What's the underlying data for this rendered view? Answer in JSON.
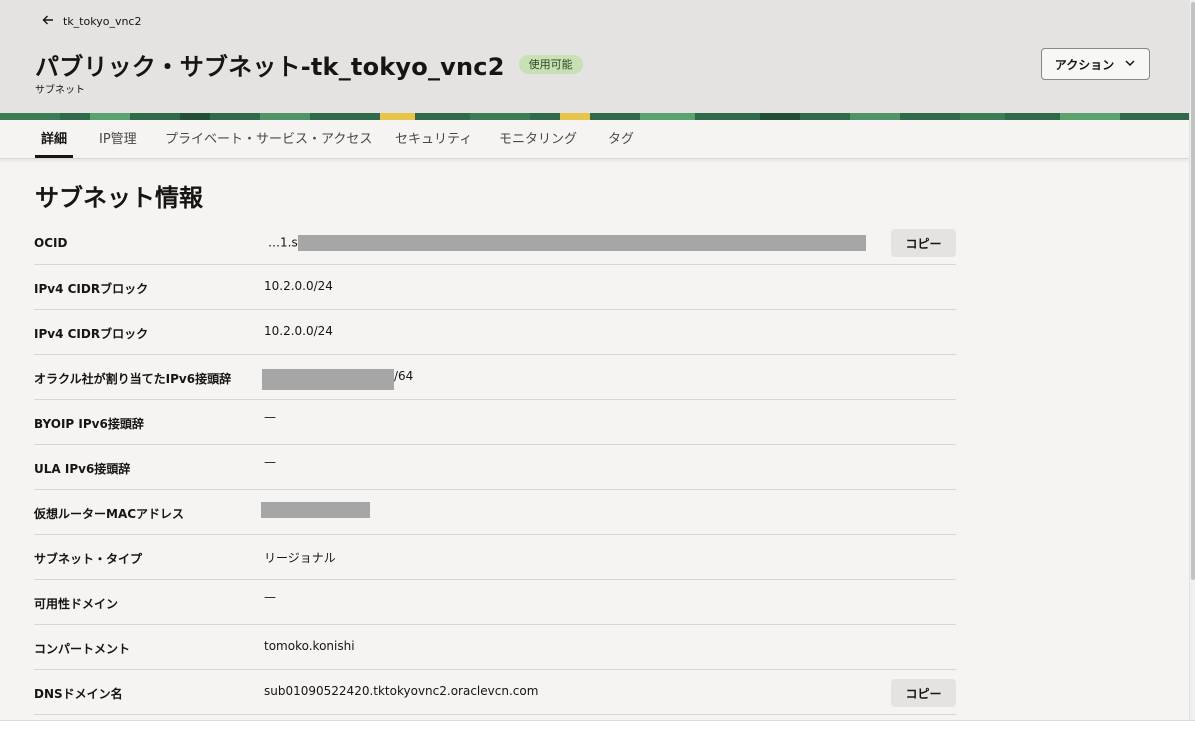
{
  "breadcrumb": {
    "label": "tk_tokyo_vnc2",
    "icon": "arrow-left-icon"
  },
  "header": {
    "title": "パブリック・サブネット-tk_tokyo_vnc2",
    "status_badge": "使用可能",
    "subtitle": "サブネット",
    "action_label": "アクション",
    "colors": {
      "badge_bg": "#c8e0b6",
      "banner_green": "#2f6b4a",
      "banner_yellow": "#e8c54a"
    }
  },
  "tabs": [
    {
      "label": "詳細",
      "active": true
    },
    {
      "label": "IP管理",
      "active": false
    },
    {
      "label": "プライベート・サービス・アクセス",
      "active": false
    },
    {
      "label": "セキュリティ",
      "active": false
    },
    {
      "label": "モニタリング",
      "active": false
    },
    {
      "label": "タグ",
      "active": false
    }
  ],
  "section": {
    "title": "サブネット情報"
  },
  "details": {
    "copy_label": "コピー",
    "rows": [
      {
        "label": "OCID",
        "value_prefix": "…1.s"
      },
      {
        "label": "IPv4 CIDRブロック",
        "value": "10.2.0.0/24"
      },
      {
        "label": "IPv4 CIDRブロック",
        "value": "10.2.0.0/24"
      },
      {
        "label": "オラクル社が割り当てたIPv6接頭辞",
        "value_suffix": "/64"
      },
      {
        "label": "BYOIP IPv6接頭辞",
        "value": "—"
      },
      {
        "label": "ULA IPv6接頭辞",
        "value": "—"
      },
      {
        "label": "仮想ルーターMACアドレス"
      },
      {
        "label": "サブネット・タイプ",
        "value": "リージョナル"
      },
      {
        "label": "可用性ドメイン",
        "value": "—"
      },
      {
        "label": "コンパートメント",
        "value": "tomoko.konishi"
      },
      {
        "label": "DNSドメイン名",
        "value": "sub01090522420.tktokyovnc2.oraclevcn.com"
      }
    ]
  }
}
